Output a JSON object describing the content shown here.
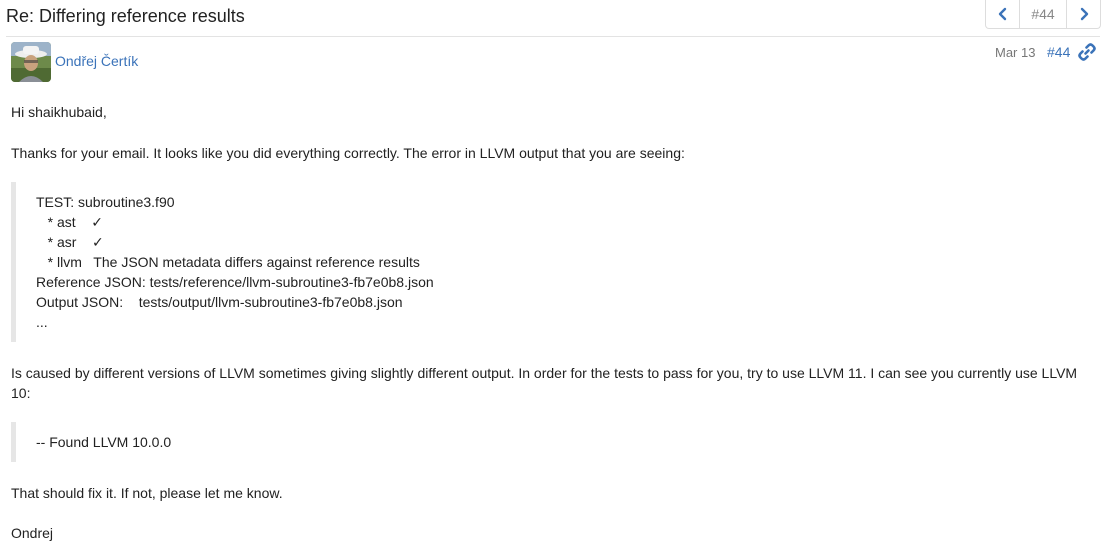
{
  "topic": {
    "title": "Re: Differing reference results"
  },
  "pager": {
    "current": "#44",
    "prev_icon": "chevron-left-icon",
    "next_icon": "chevron-right-icon"
  },
  "post": {
    "author": "Ondřej Čertík",
    "date": "Mar 13",
    "post_number": "#44",
    "greeting": "Hi shaikhubaid,",
    "para1": "Thanks for your email. It looks like you did everything correctly. The error in LLVM output that you are seeing:",
    "quote1": [
      "TEST: subroutine3.f90",
      "   * ast    ✓",
      "   * asr    ✓",
      "   * llvm   The JSON metadata differs against reference results",
      "Reference JSON: tests/reference/llvm-subroutine3-fb7e0b8.json",
      "Output JSON:    tests/output/llvm-subroutine3-fb7e0b8.json",
      "..."
    ],
    "para2_line1": "Is caused by different versions of LLVM sometimes giving slightly different output. In order for the tests to pass for you, try to use LLVM 11. I can see you currently use LLVM",
    "para2_line2": "10:",
    "quote2": "-- Found LLVM 10.0.0",
    "para3": "That should fix it. If not, please let me know.",
    "signature": "Ondrej"
  },
  "colors": {
    "link": "#3b73b9",
    "quote_border": "#e6e6e6",
    "muted": "#777777"
  }
}
